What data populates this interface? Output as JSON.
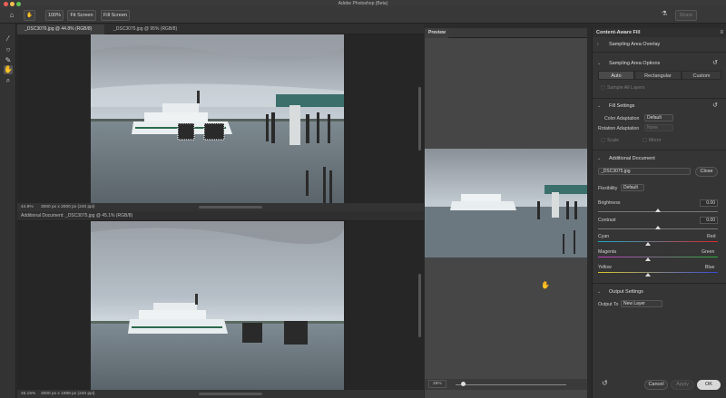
{
  "app": {
    "title": "Adobe Photoshop (Beta)",
    "traffic_colors": [
      "#ec5f56",
      "#f4bd4f",
      "#61c454"
    ]
  },
  "optionsbar": {
    "zoom_100": "100%",
    "fit_screen": "Fit Screen",
    "fill_screen": "Fill Screen",
    "share": "Share"
  },
  "tabs": [
    "_DSC3076.jpg @ 44.8% (RGB/8)",
    "_DSC3075.jpg @ 95% (RGB/8)"
  ],
  "doc1": {
    "zoom": "44.8%",
    "info": "3000 px x 2000 px (240 ppi)"
  },
  "doc2": {
    "header": "Additional Document: _DSC3075.jpg @ 45.1% (RGB/8)",
    "zoom": "45.15%",
    "info": "3000 px x 1989 px (240 ppi)"
  },
  "preview": {
    "tab": "Preview",
    "zoom": "28%",
    "zoom_fraction": 0.05
  },
  "panel": {
    "title": "Content-Aware Fill",
    "sampling_overlay": "Sampling Area Overlay",
    "sampling_options": "Sampling Area Options",
    "seg": [
      "Auto",
      "Rectangular",
      "Custom"
    ],
    "sample_all_layers": "Sample All Layers",
    "fill_settings": "Fill Settings",
    "color_adaptation_label": "Color Adaptation",
    "color_adaptation_value": "Default",
    "rotation_adaptation_label": "Rotation Adaptation",
    "rotation_adaptation_value": "None",
    "scale": "Scale",
    "mirror": "Mirror",
    "additional_document": "Additional Document",
    "doc_select": "_DSC3075.jpg",
    "close": "Close",
    "flexibility_label": "Flexibility",
    "flexibility_value": "Default",
    "brightness": "Brightness",
    "brightness_value": "0.00",
    "contrast": "Contrast",
    "contrast_value": "0.00",
    "cyan": "Cyan",
    "red": "Red",
    "magenta": "Magenta",
    "green": "Green",
    "yellow": "Yellow",
    "blue": "Blue",
    "output_settings": "Output Settings",
    "output_to_label": "Output To",
    "output_to_value": "New Layer",
    "cancel": "Cancel",
    "apply": "Apply",
    "ok": "OK"
  },
  "icons": [
    "home-icon",
    "hand-icon",
    "flask-icon",
    "brush-icon",
    "lasso-icon",
    "eyedropper-icon",
    "hand-tool-icon",
    "zoom-icon",
    "chevron-icon",
    "reset-icon"
  ]
}
